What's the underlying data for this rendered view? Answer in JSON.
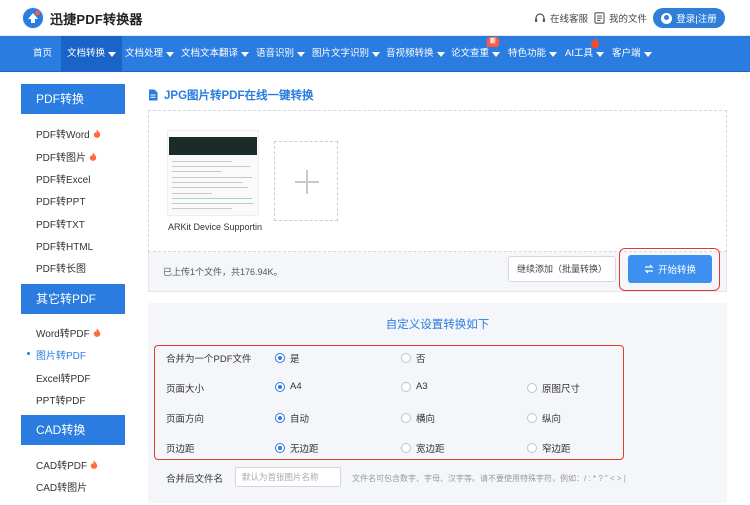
{
  "header": {
    "logo_text": "迅捷PDF转换器",
    "service_label": "在线客服",
    "files_label": "我的文件",
    "login_label": "登录|注册"
  },
  "nav": {
    "items": [
      {
        "label": "首页",
        "dropdown": false
      },
      {
        "label": "文档转换",
        "dropdown": true,
        "active": true
      },
      {
        "label": "文档处理",
        "dropdown": true
      },
      {
        "label": "文档文本翻译",
        "dropdown": true
      },
      {
        "label": "语音识别",
        "dropdown": true
      },
      {
        "label": "图片文字识别",
        "dropdown": true
      },
      {
        "label": "音视频转换",
        "dropdown": true
      },
      {
        "label": "论文查重",
        "dropdown": true,
        "badge": "新"
      },
      {
        "label": "特色功能",
        "dropdown": true
      },
      {
        "label": "AI工具",
        "dropdown": true,
        "fire": true
      },
      {
        "label": "客户端",
        "dropdown": true
      }
    ]
  },
  "sidebar": {
    "sections": [
      {
        "title": "PDF转换",
        "items": [
          {
            "label": "PDF转Word",
            "hot": true
          },
          {
            "label": "PDF转图片",
            "hot": true
          },
          {
            "label": "PDF转Excel"
          },
          {
            "label": "PDF转PPT"
          },
          {
            "label": "PDF转TXT"
          },
          {
            "label": "PDF转HTML"
          },
          {
            "label": "PDF转长图"
          }
        ]
      },
      {
        "title": "其它转PDF",
        "items": [
          {
            "label": "Word转PDF",
            "hot": true
          },
          {
            "label": "图片转PDF",
            "current": true
          },
          {
            "label": "Excel转PDF"
          },
          {
            "label": "PPT转PDF"
          }
        ]
      },
      {
        "title": "CAD转换",
        "items": [
          {
            "label": "CAD转PDF",
            "hot": true
          },
          {
            "label": "CAD转图片"
          }
        ]
      }
    ]
  },
  "main": {
    "title": "JPG图片转PDF在线一键转换",
    "file_name": "ARKit Device Supportin...",
    "status_text": "已上传1个文件，共176.94K。",
    "batch_button": "继续添加（批量转换）",
    "start_button": "开始转换"
  },
  "settings": {
    "title": "自定义设置转换如下",
    "rows": [
      {
        "label": "合并为一个PDF文件",
        "options": [
          "是",
          "否"
        ],
        "selected": 0
      },
      {
        "label": "页面大小",
        "options": [
          "A4",
          "A3",
          "原图尺寸"
        ],
        "selected": 0
      },
      {
        "label": "页面方向",
        "options": [
          "自动",
          "横向",
          "纵向"
        ],
        "selected": 0
      },
      {
        "label": "页边距",
        "options": [
          "无边距",
          "宽边距",
          "窄边距"
        ],
        "selected": 0
      }
    ],
    "filename_label": "合并后文件名",
    "filename_placeholder": "默认为首张图片名称",
    "filename_hint": "文件名可包含数字、字母、汉字等。请不要使用特殊字符，例如：/ : * ? \" < > |"
  },
  "colors": {
    "primary": "#2b7ce0",
    "highlight_border": "#e23b2e",
    "hot": "#ff5a3c"
  }
}
